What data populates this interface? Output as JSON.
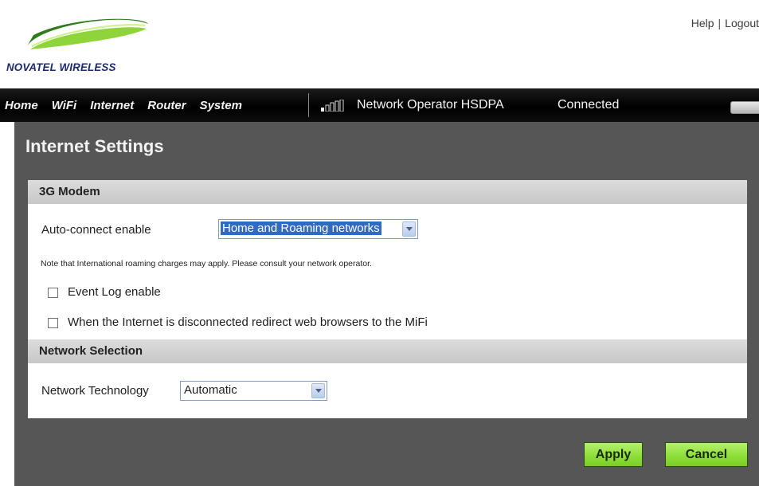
{
  "brand": {
    "logo_text": "NOVATEL WIRELESS",
    "swoosh_colors": [
      "#2e7d1a",
      "#8fd43a"
    ]
  },
  "top_links": {
    "help": "Help",
    "separator": "|",
    "logout": "Logout"
  },
  "nav": {
    "items": [
      {
        "label": "Home"
      },
      {
        "label": "WiFi"
      },
      {
        "label": "Internet"
      },
      {
        "label": "Router"
      },
      {
        "label": "System"
      }
    ],
    "signal_icon": "signal-bars-icon",
    "operator": "Network Operator HSDPA",
    "connection_status": "Connected",
    "battery_icon": "battery-icon"
  },
  "page": {
    "title": "Internet Settings",
    "sections": {
      "modem": {
        "header": "3G Modem",
        "auto_connect_label": "Auto-connect enable",
        "auto_connect_value": "Home and Roaming networks",
        "note": "Note that International roaming charges may apply. Please consult your network operator.",
        "event_log_label": "Event Log enable",
        "event_log_checked": false,
        "redirect_label": "When the Internet is disconnected redirect web browsers to the MiFi",
        "redirect_checked": false
      },
      "network": {
        "header": "Network Selection",
        "technology_label": "Network Technology",
        "technology_value": "Automatic"
      }
    },
    "buttons": {
      "apply": "Apply",
      "cancel": "Cancel"
    }
  },
  "colors": {
    "nav_background": "#000000",
    "content_background": "#565656",
    "button_green": "#8ee038",
    "select_highlight": "#316ac5"
  }
}
